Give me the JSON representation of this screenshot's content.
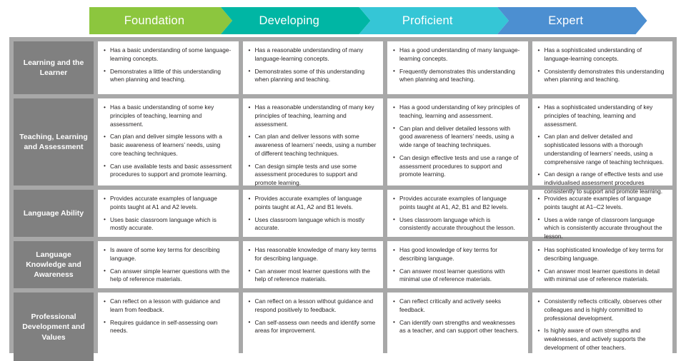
{
  "header": {
    "stages": [
      {
        "label": "Foundation",
        "color": "#8CC63E"
      },
      {
        "label": "Developing",
        "color": "#00B6A4"
      },
      {
        "label": "Proficient",
        "color": "#35C6D6"
      },
      {
        "label": "Expert",
        "color": "#4C8FD1"
      }
    ]
  },
  "colors": {
    "panel_background": "#a8a8a8",
    "row_header_background": "#808080",
    "cell_background": "#ffffff",
    "text": "#231f20"
  },
  "rows": [
    {
      "header": "Learning and the Learner",
      "cells": [
        [
          "Has a basic understanding of some language-learning concepts.",
          "Demonstrates a little of this understanding when planning and teaching."
        ],
        [
          "Has a reasonable understanding of many language-learning concepts.",
          "Demonstrates some of this understanding when planning and teaching."
        ],
        [
          "Has a good understanding of many language-learning concepts.",
          "Frequently demonstrates this understanding when planning and teaching."
        ],
        [
          "Has a sophisticated understanding of language-learning concepts.",
          "Consistently demonstrates this understanding when planning and teaching."
        ]
      ]
    },
    {
      "header": "Teaching, Learning and Assessment",
      "cells": [
        [
          "Has a basic understanding of some key principles of teaching, learning and assessment.",
          "Can plan and deliver simple lessons with a basic awareness of learners’ needs, using core teaching techniques.",
          "Can use available tests and basic assessment procedures to support and promote learning."
        ],
        [
          "Has a reasonable understanding of many key principles of teaching, learning and assessment.",
          "Can plan and deliver lessons with some awareness of learners’ needs, using a number of different teaching techniques.",
          "Can design simple tests and use some assessment procedures to support and promote learning."
        ],
        [
          "Has a good understanding of key principles of teaching, learning and assessment.",
          "Can plan and deliver detailed lessons with good awareness of learners’ needs, using a wide range of teaching techniques.",
          "Can design effective tests and use a range of assessment procedures to support and promote learning."
        ],
        [
          "Has a sophisticated understanding of key principles of teaching, learning and assessment.",
          "Can plan and deliver detailed and sophisticated lessons with a thorough understanding of learners’ needs, using a comprehensive range of teaching techniques.",
          "Can design a range of effective tests and use individualised assessment procedures consistently to support and promote learning."
        ]
      ]
    },
    {
      "header": "Language Ability",
      "cells": [
        [
          "Provides accurate examples of language points taught at A1 and A2 levels.",
          "Uses basic classroom language which is mostly accurate."
        ],
        [
          "Provides accurate examples of language points taught at A1, A2 and B1 levels.",
          "Uses classroom language which is mostly accurate."
        ],
        [
          "Provides accurate examples of language points taught at A1, A2, B1 and B2 levels.",
          "Uses classroom language which is consistently accurate throughout the lesson."
        ],
        [
          "Provides accurate examples of language points taught at A1–C2 levels.",
          "Uses a wide range of classroom language which is consistently accurate throughout the lesson."
        ]
      ]
    },
    {
      "header": "Language Knowledge and Awareness",
      "cells": [
        [
          "Is aware of some key terms for describing language.",
          "Can answer simple learner questions with the help of reference materials."
        ],
        [
          "Has reasonable knowledge of many key terms for describing language.",
          "Can answer most learner questions with the help of reference materials."
        ],
        [
          "Has good knowledge of key terms for describing language.",
          "Can answer most learner questions with minimal use of reference materials."
        ],
        [
          "Has sophisticated knowledge of key terms for describing language.",
          "Can answer most learner questions in detail with minimal use of reference materials."
        ]
      ]
    },
    {
      "header": "Professional Development and Values",
      "cells": [
        [
          "Can reflect on a lesson with guidance and learn from feedback.",
          "Requires guidance in self-assessing own needs."
        ],
        [
          "Can reflect on a lesson without guidance and respond positively to feedback.",
          "Can self-assess own needs and identify some areas for improvement."
        ],
        [
          "Can reflect critically and actively seeks feedback.",
          "Can identify own strengths and weaknesses as a teacher, and can support other teachers."
        ],
        [
          "Consistently reflects critically, observes other colleagues and is highly committed to professional development.",
          "Is highly aware of own strengths and weaknesses, and actively supports the development of other teachers."
        ]
      ]
    }
  ]
}
